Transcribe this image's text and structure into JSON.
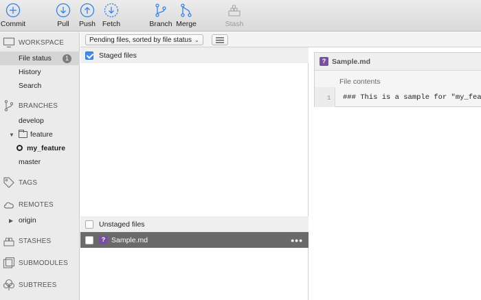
{
  "toolbar": {
    "commit": "Commit",
    "pull": "Pull",
    "push": "Push",
    "fetch": "Fetch",
    "branch": "Branch",
    "merge": "Merge",
    "stash": "Stash"
  },
  "sidebar": {
    "workspace": "WORKSPACE",
    "file_status": "File status",
    "file_status_count": "1",
    "history": "History",
    "search": "Search",
    "branches": "BRANCHES",
    "branch_develop": "develop",
    "folder_feature": "feature",
    "branch_my_feature": "my_feature",
    "branch_master": "master",
    "tags": "TAGS",
    "remotes": "REMOTES",
    "remote_origin": "origin",
    "stashes": "STASHES",
    "submodules": "SUBMODULES",
    "subtrees": "SUBTREES"
  },
  "filter": {
    "selected": "Pending files, sorted by file status"
  },
  "files": {
    "staged_title": "Staged files",
    "unstaged_title": "Unstaged files",
    "file_name": "Sample.md",
    "file_status_symbol": "?"
  },
  "viewer": {
    "file_name": "Sample.md",
    "contents_label": "File contents",
    "line_number": "1",
    "line_text": "### This is a sample for \"my_feature\""
  },
  "colors": {
    "accent": "#3c8cf3",
    "selected_row": "#6a6a6a",
    "untracked_badge": "#7a4fa0"
  }
}
